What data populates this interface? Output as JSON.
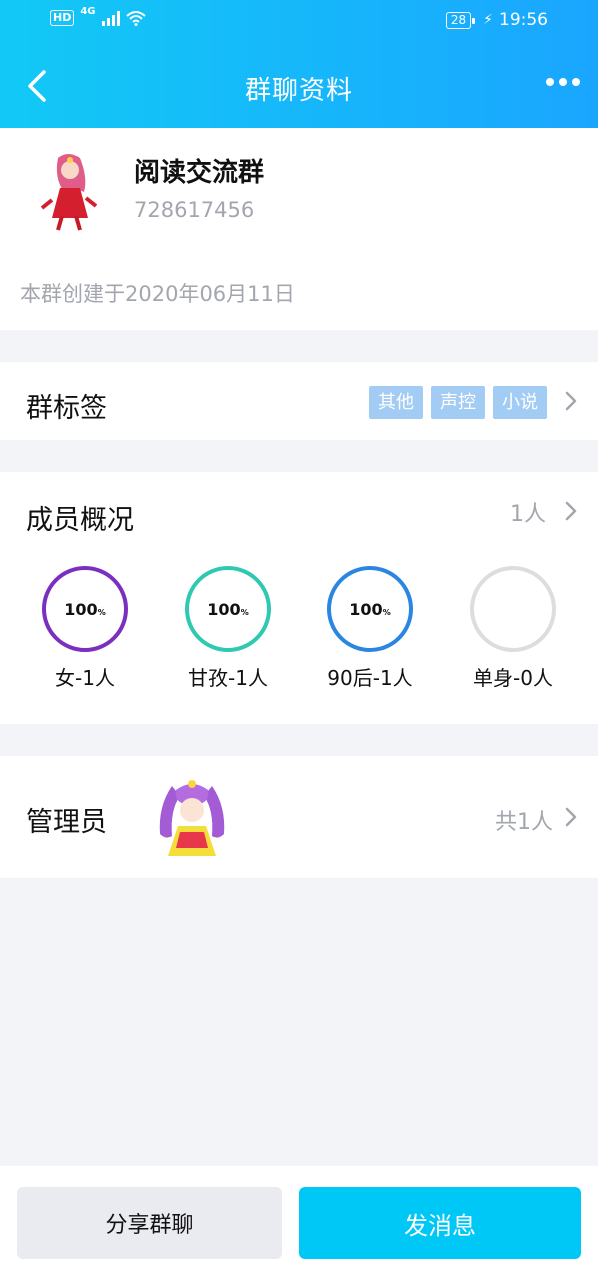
{
  "status_bar": {
    "hd": "HD",
    "network": "4G",
    "battery": "28",
    "time": "19:56"
  },
  "header": {
    "title": "群聊资料"
  },
  "group": {
    "name": "阅读交流群",
    "id": "728617456",
    "created": "本群创建于2020年06月11日"
  },
  "tags": {
    "label": "群标签",
    "items": [
      "其他",
      "声控",
      "小说"
    ],
    "tag_color": "#a3ccf5"
  },
  "members": {
    "label": "成员概况",
    "count": "1人",
    "stats": [
      {
        "percent": "100",
        "unit": "%",
        "label": "女-1人",
        "color": "#7b2fbf"
      },
      {
        "percent": "100",
        "unit": "%",
        "label": "甘孜-1人",
        "color": "#2ec9b0"
      },
      {
        "percent": "100",
        "unit": "%",
        "label": "90后-1人",
        "color": "#2a86e0"
      },
      {
        "percent": "",
        "unit": "",
        "label": "单身-0人",
        "color": "#dddddd"
      }
    ]
  },
  "admin": {
    "label": "管理员",
    "count": "共1人"
  },
  "actions": {
    "share": "分享群聊",
    "send": "发消息"
  },
  "colors": {
    "header_start": "#12c9f6",
    "header_end": "#1aa6ff",
    "primary_button": "#00c8f6"
  }
}
